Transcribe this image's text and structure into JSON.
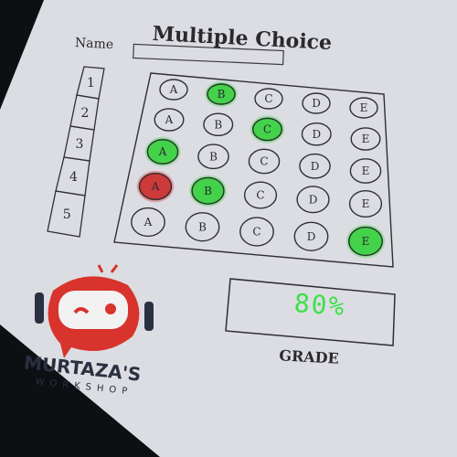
{
  "sheet": {
    "title": "Multiple Choice",
    "name_label": "Name",
    "question_numbers": [
      "1",
      "2",
      "3",
      "4",
      "5"
    ],
    "options": [
      "A",
      "B",
      "C",
      "D",
      "E"
    ],
    "marks": [
      {
        "question": "1",
        "option": "B",
        "status": "correct"
      },
      {
        "question": "2",
        "option": "C",
        "status": "correct"
      },
      {
        "question": "3",
        "option": "A",
        "status": "correct"
      },
      {
        "question": "4",
        "option": "A",
        "status": "wrong"
      },
      {
        "question": "4",
        "option": "B",
        "status": "correct-answer"
      },
      {
        "question": "5",
        "option": "E",
        "status": "correct"
      }
    ],
    "grade_value": "80%",
    "grade_label": "GRADE"
  },
  "logo": {
    "brand": "MURTAZA'S",
    "subtitle": "WORKSHOP"
  },
  "colors": {
    "correct": "#43d24a",
    "wrong": "#cc3a3a",
    "grade_text": "#3ce04a",
    "logo_red": "#d8332c",
    "logo_navy": "#2a3040"
  }
}
